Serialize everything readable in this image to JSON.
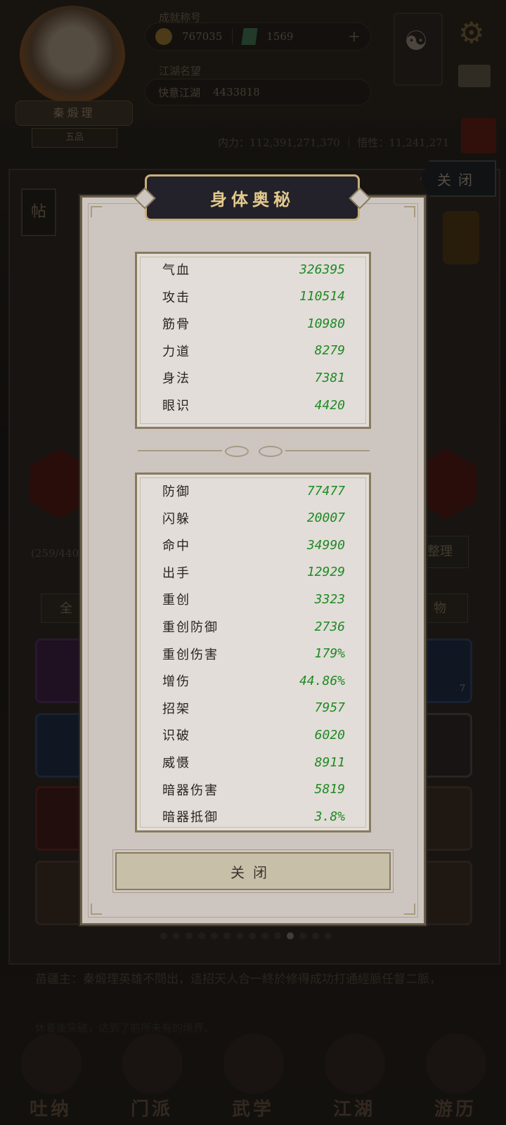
{
  "background": {
    "player_name": "秦煅理",
    "player_sub": "五品",
    "currency_coins": "767035",
    "currency_gems": "1569",
    "title_label": "江湖名望",
    "title_top_label": "成就称号",
    "rank_text": "快意江湖",
    "rank_value": "4433818",
    "power_line": "内力：112,391,271,370 ｜ 悟性：11,241,271",
    "close_top": "关闭",
    "tie_tag": "帖",
    "side_text": "(259/440)",
    "sort_button": "整理",
    "tab_all": "全",
    "tab_item": "物",
    "slot_count": "7",
    "story_line1": "苗疆主：秦煅理英雄不問出，這招天人合一終於修得成功打通經脈任督二脈，",
    "story_line2": "休養後突破，达到了前所未有的境界。",
    "nav": [
      {
        "label": "吐纳"
      },
      {
        "label": "门派"
      },
      {
        "label": "武学"
      },
      {
        "label": "江湖"
      },
      {
        "label": "游历"
      }
    ],
    "pager_count": 14,
    "pager_active": 10
  },
  "modal": {
    "title": "身体奥秘",
    "close_label": "关闭",
    "stats_primary": [
      {
        "label": "气血",
        "value": "326395"
      },
      {
        "label": "攻击",
        "value": "110514"
      },
      {
        "label": "筋骨",
        "value": "10980"
      },
      {
        "label": "力道",
        "value": "8279"
      },
      {
        "label": "身法",
        "value": "7381"
      },
      {
        "label": "眼识",
        "value": "4420"
      }
    ],
    "stats_secondary": [
      {
        "label": "防御",
        "value": "77477"
      },
      {
        "label": "闪躲",
        "value": "20007"
      },
      {
        "label": "命中",
        "value": "34990"
      },
      {
        "label": "出手",
        "value": "12929"
      },
      {
        "label": "重创",
        "value": "3323"
      },
      {
        "label": "重创防御",
        "value": "2736"
      },
      {
        "label": "重创伤害",
        "value": "179%"
      },
      {
        "label": "增伤",
        "value": "44.86%"
      },
      {
        "label": "招架",
        "value": "7957"
      },
      {
        "label": "识破",
        "value": "6020"
      },
      {
        "label": "威慑",
        "value": "8911"
      },
      {
        "label": "暗器伤害",
        "value": "5819"
      },
      {
        "label": "暗器抵御",
        "value": "3.8%"
      }
    ]
  },
  "colors": {
    "stat_value": "#1f8a24",
    "title_text": "#e3c98c",
    "modal_bg": "#cdc6c0"
  }
}
